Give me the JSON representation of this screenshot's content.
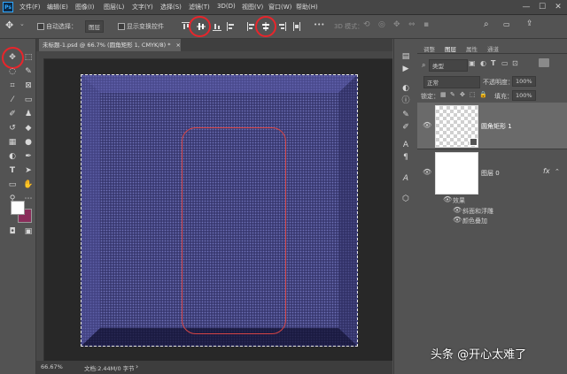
{
  "app": {
    "logo": "Ps"
  },
  "menubar": {
    "items": [
      "文件(F)",
      "编辑(E)",
      "图像(I)",
      "图层(L)",
      "文字(Y)",
      "选择(S)",
      "滤镜(T)",
      "3D(D)",
      "视图(V)",
      "窗口(W)",
      "帮助(H)"
    ],
    "window_controls": [
      "—",
      "☐",
      "✕"
    ]
  },
  "options_bar": {
    "auto_select_label": "自动选择：",
    "auto_select_value": "图层",
    "show_transform_label": "显示变换控件",
    "mode_3d_label": "3D 模式：",
    "more": "•••"
  },
  "document": {
    "tab_title": "未标题-1.psd @ 66.7% (圆角矩形 1, CMYK/8) *",
    "tab_close": "×",
    "zoom": "66.67%",
    "doc_info": "文档:2.44M/0 字节"
  },
  "panel": {
    "tabs": [
      "调整",
      "图层",
      "属性",
      "通道"
    ],
    "filter_kind": "类型",
    "blend_mode": "正常",
    "opacity_label": "不透明度：",
    "opacity_value": "100%",
    "lock_label": "锁定：",
    "fill_label": "填充：",
    "fill_value": "100%",
    "layers": [
      {
        "name": "圆角矩形 1"
      },
      {
        "name": "图层 0",
        "fx": "fx"
      }
    ],
    "effects_label": "效果",
    "effects": [
      "斜面和浮雕",
      "颜色叠加"
    ]
  },
  "colors": {
    "foreground": "#ffffff",
    "background": "#8a2d5a",
    "canvas": "#3a3a72",
    "highlight_circle": "#e8252b",
    "shape_stroke": "#d74545"
  },
  "watermark": "头条 @开心太难了"
}
